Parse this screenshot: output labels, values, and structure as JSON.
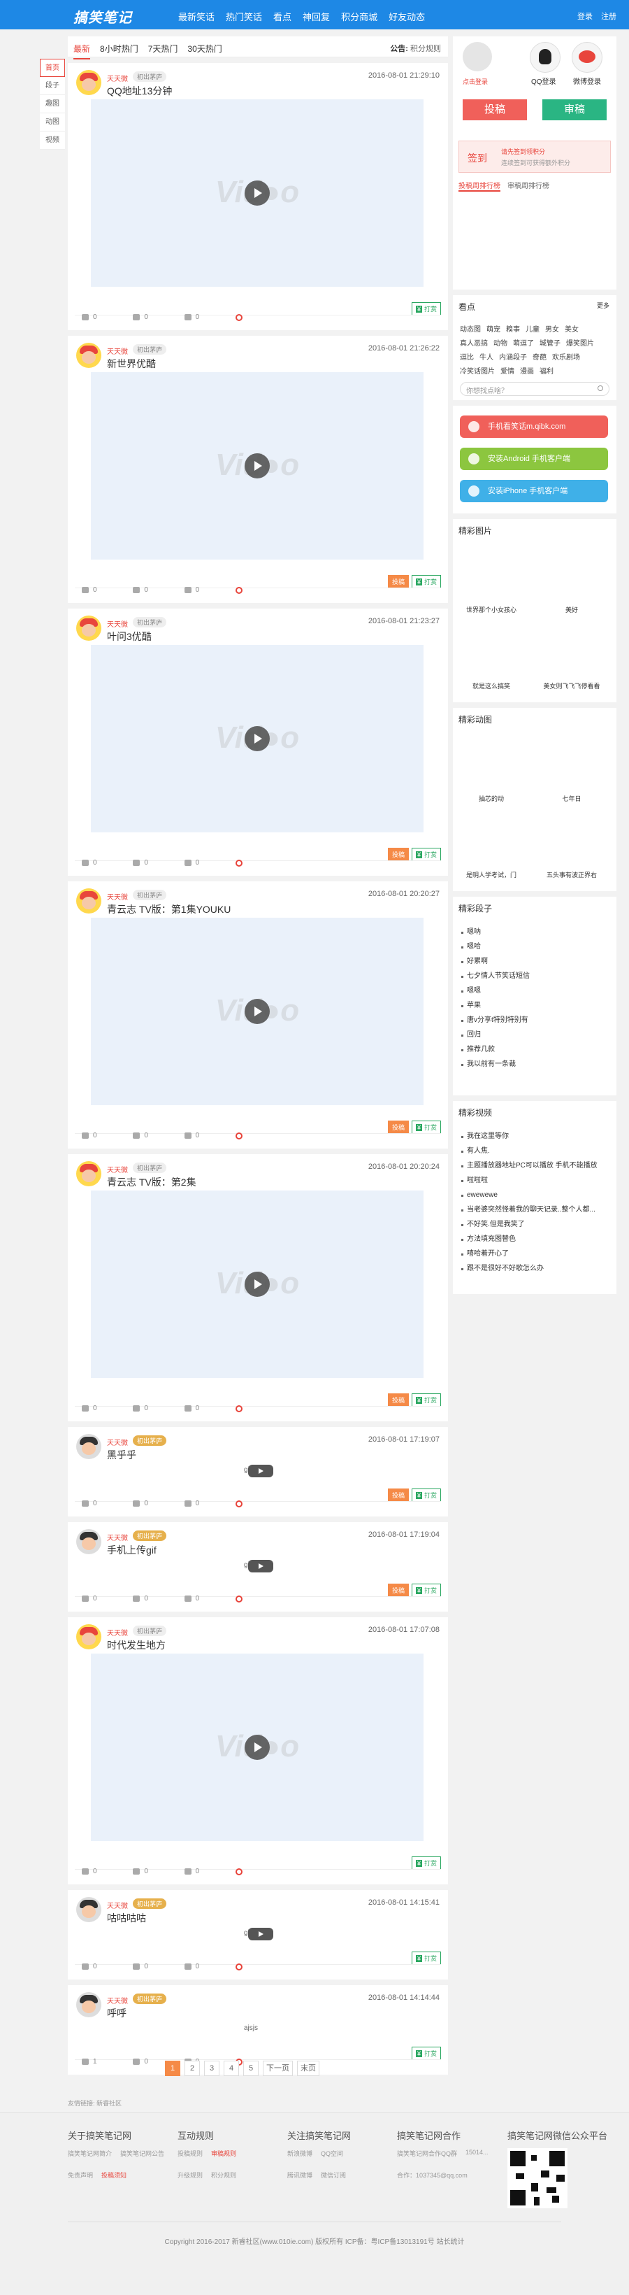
{
  "header": {
    "logo": "搞笑笔记",
    "nav": [
      "最新笑话",
      "热门笑话",
      "看点",
      "神回复",
      "积分商城",
      "好友动态"
    ],
    "links": [
      "登录",
      "注册"
    ]
  },
  "sidenav": [
    "首页",
    "段子",
    "趣图",
    "动图",
    "视频"
  ],
  "tabs": {
    "items": [
      "最新",
      "8小时热门",
      "7天热门",
      "30天热门"
    ],
    "notice_label": "公告:",
    "notice_text": "积分规则"
  },
  "posts": [
    {
      "user": "天天微",
      "level": "初出茅庐",
      "time": "2016-08-01 21:29:10",
      "title": "QQ地址13分钟",
      "media": "video",
      "watermark": "Vid●o",
      "likes": "0",
      "dislikes": "0",
      "comments": "0",
      "report": "",
      "reward": "打赏"
    },
    {
      "user": "天天微",
      "level": "初出茅庐",
      "time": "2016-08-01 21:26:22",
      "title": "新世界优酷",
      "media": "video",
      "watermark": "Vid●o",
      "likes": "0",
      "dislikes": "0",
      "comments": "0",
      "report": "投稿",
      "reward": "打赏"
    },
    {
      "user": "天天微",
      "level": "初出茅庐",
      "time": "2016-08-01 21:23:27",
      "title": "叶问3优酷",
      "media": "video",
      "watermark": "Vid●o",
      "likes": "0",
      "dislikes": "0",
      "comments": "0",
      "report": "投稿",
      "reward": "打赏"
    },
    {
      "user": "天天微",
      "level": "初出茅庐",
      "time": "2016-08-01 20:20:27",
      "title": "青云志 TV版：第1集YOUKU",
      "media": "video",
      "watermark": "Vid●o",
      "likes": "0",
      "dislikes": "0",
      "comments": "0",
      "report": "投稿",
      "reward": "打赏"
    },
    {
      "user": "天天微",
      "level": "初出茅庐",
      "time": "2016-08-01 20:20:24",
      "title": "青云志 TV版：第2集",
      "media": "video",
      "watermark": "Vid●o",
      "likes": "0",
      "dislikes": "0",
      "comments": "0",
      "report": "投稿",
      "reward": "打赏"
    },
    {
      "user": "天天微",
      "level": "初出茅庐",
      "time": "2016-08-01 17:19:07",
      "title": "黑乎乎",
      "media": "small",
      "broken": "gif",
      "likes": "0",
      "dislikes": "0",
      "comments": "0",
      "report": "投稿",
      "reward": "打赏"
    },
    {
      "user": "天天微",
      "level": "初出茅庐",
      "time": "2016-08-01 17:19:04",
      "title": "手机上传gif",
      "media": "small",
      "broken": "gif",
      "likes": "0",
      "dislikes": "0",
      "comments": "0",
      "report": "投稿",
      "reward": "打赏"
    },
    {
      "user": "天天微",
      "level": "初出茅庐",
      "time": "2016-08-01 17:07:08",
      "title": "时代发生地方",
      "media": "video",
      "watermark": "Vid●o",
      "likes": "0",
      "dislikes": "0",
      "comments": "0",
      "report": "",
      "reward": "打赏"
    },
    {
      "user": "天天微",
      "level": "初出茅庐",
      "time": "2016-08-01 14:15:41",
      "title": "咕咕咕咕",
      "media": "small",
      "broken": "gb",
      "likes": "0",
      "dislikes": "0",
      "comments": "0",
      "report": "",
      "reward": "打赏"
    },
    {
      "user": "天天微",
      "level": "初出茅庐",
      "time": "2016-08-01 14:14:44",
      "title": "呼呼",
      "media": "img",
      "broken": "ajsjs",
      "likes": "1",
      "dislikes": "0",
      "comments": "0",
      "report": "",
      "reward": "打赏"
    }
  ],
  "pager": [
    "1",
    "2",
    "3",
    "4",
    "5",
    "下一页",
    "末页"
  ],
  "sidebar": {
    "login_label": "点击登录",
    "qq_label": "QQ登录",
    "weibo_label": "微博登录",
    "post_btn": "投稿",
    "review_btn": "审稿",
    "sign_label": "签到",
    "sign_tip": "请先签到领积分",
    "sign_sub": "连续签到可获得额外积分",
    "rank_tabs": [
      "投稿周排行榜",
      "审稿周排行榜"
    ],
    "tags_title": "看点",
    "tags_more": "更多",
    "tags": [
      "动态图",
      "萌宠",
      "糗事",
      "儿童",
      "男女",
      "美女",
      "真人恶搞",
      "动物",
      "萌逗了",
      "城管子",
      "爆笑图片",
      "逗比",
      "牛人",
      "内涵段子",
      "奇葩",
      "欢乐剧场",
      "冷笑话图片",
      "爱情",
      "漫画",
      "福利"
    ],
    "search_placeholder": "你想找点啥？",
    "app_buttons": [
      {
        "label": "手机看笑话m.qibk.com",
        "color": "#f0605a"
      },
      {
        "label": "安装Android 手机客户端",
        "color": "#8cc63f"
      },
      {
        "label": "安装iPhone 手机客户端",
        "color": "#3fb0e8"
      }
    ],
    "pics_title": "精彩图片",
    "pics": [
      "世界那个小女孩心",
      "美好",
      "就是这么搞笑",
      "美女则飞飞飞停看看"
    ],
    "gifs_title": "精彩动图",
    "gifs": [
      "抽芯的动",
      "七年日",
      "是明人学考试，门",
      "五头事有波正界右"
    ],
    "jokes_title": "精彩段子",
    "jokes": [
      "嗯呐",
      "嗯哈",
      "好累啊",
      "七夕情人节笑话短信",
      "嗯嗯",
      "苹果",
      "唐v分享t特别特别有",
      "回归",
      "推荐几款",
      "我以前有一条裁"
    ],
    "videos_title": "精彩视频",
    "videos": [
      "我在这里等你",
      "有人焦.",
      "主题播放器地址PC可以播放 手机不能播放",
      "啦啦啦",
      "ewewewe",
      "当老婆突然怪着我的聊天记录..整个人都...",
      "不好笑.但是我笑了",
      "方法填充图替色",
      "嘻哈着开心了",
      "跟不是很好不好歌怎么办"
    ]
  },
  "friend_links": "友情链接: 新睿社区",
  "footer": {
    "cols": [
      {
        "title": "关于搞笑笔记网",
        "rows": [
          [
            "搞笑笔记网简介",
            "搞笑笔记网公告"
          ],
          [
            "免责声明",
            "投稿须知"
          ]
        ]
      },
      {
        "title": "互动规则",
        "rows": [
          [
            "投稿规则",
            "审稿规则"
          ],
          [
            "升级规则",
            "积分规则"
          ]
        ]
      },
      {
        "title": "关注搞笑笔记网",
        "rows": [
          [
            "新浪微博",
            "QQ空间"
          ],
          [
            "腾讯微博",
            "微信订阅"
          ]
        ]
      },
      {
        "title": "搞笑笔记网合作",
        "rows": [
          [
            "搞笑笔记网合作QQ群",
            "15014..."
          ],
          [
            "合作：1037345@qq.com"
          ]
        ]
      },
      {
        "title": "搞笑笔记网微信公众平台",
        "rows": []
      }
    ],
    "copyright": "Copyright 2016-2017 新睿社区(www.010ie.com) 版权所有  ICP备：粤ICP备13013191号  站长统计"
  }
}
